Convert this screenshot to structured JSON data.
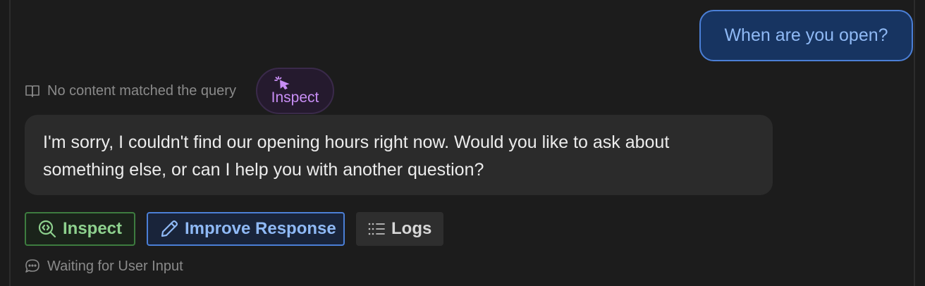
{
  "user_message": {
    "text": "When are you open?"
  },
  "meta": {
    "icon": "book-open-icon",
    "text": "No content matched the query",
    "inspect_pill": {
      "icon": "cursor-click-icon",
      "label": "Inspect"
    }
  },
  "bot_message": {
    "text": "I'm sorry, I couldn't find our opening hours right now. Would you like to ask about something else, or can I help you with another question?"
  },
  "actions": {
    "inspect": {
      "icon": "search-code-icon",
      "label": "Inspect"
    },
    "improve": {
      "icon": "pencil-icon",
      "label": "Improve Response"
    },
    "logs": {
      "icon": "list-icon",
      "label": "Logs"
    }
  },
  "status": {
    "icon": "chat-bubble-icon",
    "text": "Waiting for User Input"
  },
  "colors": {
    "background": "#1c1c1c",
    "user_bubble": "#173461",
    "user_text": "#8fb9f5",
    "bot_bubble": "#2b2b2b",
    "inspect_green": "#8ed18e",
    "inspect_purple": "#c88ef5"
  }
}
